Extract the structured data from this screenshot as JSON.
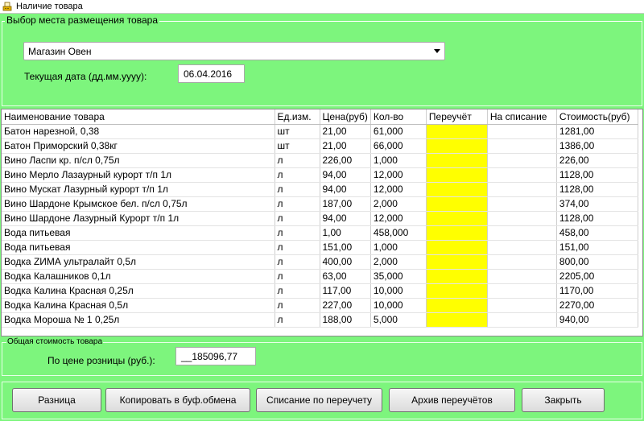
{
  "window": {
    "title": "Наличие товара",
    "icon": "cash-register-icon"
  },
  "location_group": {
    "label": "Выбор места размещения товара",
    "store_select": {
      "value": "Магазин Овен"
    },
    "date_label": "Текущая дата (дд.мм.уууу):",
    "date_value": "06.04.2016"
  },
  "grid": {
    "columns": [
      "Наименование товара",
      "Ед.изм.",
      "Цена(руб)",
      "Кол-во",
      "Переучёт",
      "На списание",
      "Стоимость(руб)"
    ],
    "rows": [
      {
        "name": "Батон нарезной, 0,38",
        "unit": "шт",
        "price": "21,00",
        "qty": "61,000",
        "recount": "",
        "writeoff": "",
        "cost": "1281,00"
      },
      {
        "name": "Батон Приморский 0,38кг",
        "unit": "шт",
        "price": "21,00",
        "qty": "66,000",
        "recount": "",
        "writeoff": "",
        "cost": "1386,00"
      },
      {
        "name": "Вино Ласпи кр. п/сл 0,75л",
        "unit": "л",
        "price": "226,00",
        "qty": "1,000",
        "recount": "",
        "writeoff": "",
        "cost": "226,00"
      },
      {
        "name": "Вино Мерло Лазаурный курорт  т/п 1л",
        "unit": "л",
        "price": "94,00",
        "qty": "12,000",
        "recount": "",
        "writeoff": "",
        "cost": "1128,00"
      },
      {
        "name": "Вино Мускат Лазурный курорт т/п 1л",
        "unit": "л",
        "price": "94,00",
        "qty": "12,000",
        "recount": "",
        "writeoff": "",
        "cost": "1128,00"
      },
      {
        "name": "Вино Шардоне Крымское бел. п/сл 0,75л",
        "unit": "л",
        "price": "187,00",
        "qty": "2,000",
        "recount": "",
        "writeoff": "",
        "cost": "374,00"
      },
      {
        "name": "Вино Шардоне Лазурный Курорт т/п 1л",
        "unit": "л",
        "price": "94,00",
        "qty": "12,000",
        "recount": "",
        "writeoff": "",
        "cost": "1128,00"
      },
      {
        "name": "Вода питьевая",
        "unit": "л",
        "price": "1,00",
        "qty": "458,000",
        "recount": "",
        "writeoff": "",
        "cost": "458,00"
      },
      {
        "name": "Вода питьевая",
        "unit": "л",
        "price": "151,00",
        "qty": "1,000",
        "recount": "",
        "writeoff": "",
        "cost": "151,00"
      },
      {
        "name": "Водка ZИМА ультралайт 0,5л",
        "unit": "л",
        "price": "400,00",
        "qty": "2,000",
        "recount": "",
        "writeoff": "",
        "cost": "800,00"
      },
      {
        "name": "Водка Калашников 0,1л",
        "unit": "л",
        "price": "63,00",
        "qty": "35,000",
        "recount": "",
        "writeoff": "",
        "cost": "2205,00"
      },
      {
        "name": "Водка Калина Красная 0,25л",
        "unit": "л",
        "price": "117,00",
        "qty": "10,000",
        "recount": "",
        "writeoff": "",
        "cost": "1170,00"
      },
      {
        "name": "Водка Калина Красная 0,5л",
        "unit": "л",
        "price": "227,00",
        "qty": "10,000",
        "recount": "",
        "writeoff": "",
        "cost": "2270,00"
      },
      {
        "name": "Водка Мороша № 1 0,25л",
        "unit": "л",
        "price": "188,00",
        "qty": "5,000",
        "recount": "",
        "writeoff": "",
        "cost": "940,00"
      }
    ],
    "recount_color": "#ffff00"
  },
  "total_group": {
    "label": "Общая стоимость товара",
    "retail_label": "По цене розницы (руб.):",
    "retail_value": "__185096,77"
  },
  "buttons": {
    "difference": "Разница",
    "copy": "Копировать в буф.обмена",
    "writeoff_by_recount": "Списание по переучету",
    "archive": "Архив переучётов",
    "close": "Закрыть"
  },
  "colors": {
    "background": "#7df57d",
    "recount_cell": "#ffff00"
  }
}
